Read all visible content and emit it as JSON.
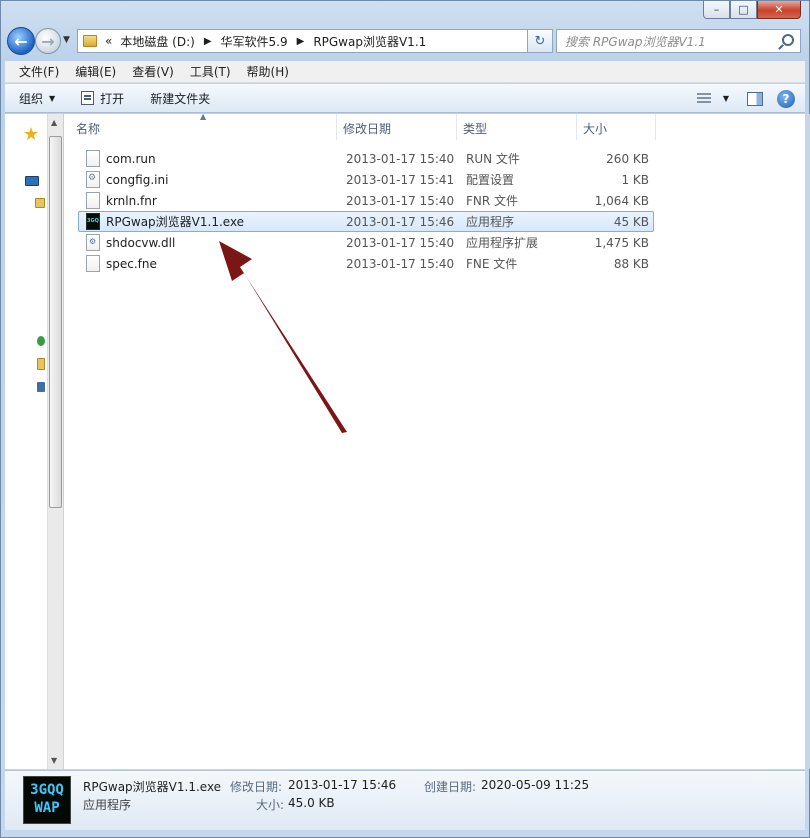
{
  "window": {
    "minimize": "–",
    "maximize": "□",
    "close": "✕"
  },
  "address": {
    "overflow": "«",
    "crumbs": [
      "本地磁盘 (D:)",
      "华军软件5.9",
      "RPGwap浏览器V1.1"
    ],
    "sep": "▶",
    "dropdown": "▼",
    "refresh": "↻"
  },
  "search": {
    "placeholder": "搜索 RPGwap浏览器V1.1"
  },
  "menu": [
    "文件(F)",
    "编辑(E)",
    "查看(V)",
    "工具(T)",
    "帮助(H)"
  ],
  "toolbar": {
    "organize": "组织",
    "open": "打开",
    "new_folder": "新建文件夹",
    "help": "?"
  },
  "columns": {
    "name": "名称",
    "date": "修改日期",
    "type": "类型",
    "size": "大小"
  },
  "files": [
    {
      "name": "com.run",
      "date": "2013-01-17 15:40",
      "type": "RUN 文件",
      "size": "260 KB",
      "icon": "file-icon"
    },
    {
      "name": "congfig.ini",
      "date": "2013-01-17 15:41",
      "type": "配置设置",
      "size": "1 KB",
      "icon": "config-file-icon"
    },
    {
      "name": "krnln.fnr",
      "date": "2013-01-17 15:40",
      "type": "FNR 文件",
      "size": "1,064 KB",
      "icon": "file-icon"
    },
    {
      "name": "RPGwap浏览器V1.1.exe",
      "date": "2013-01-17 15:46",
      "type": "应用程序",
      "size": "45 KB",
      "icon": "app-icon",
      "selected": true
    },
    {
      "name": "shdocvw.dll",
      "date": "2013-01-17 15:40",
      "type": "应用程序扩展",
      "size": "1,475 KB",
      "icon": "dll-icon"
    },
    {
      "name": "spec.fne",
      "date": "2013-01-17 15:40",
      "type": "FNE 文件",
      "size": "88 KB",
      "icon": "file-icon"
    }
  ],
  "details": {
    "name": "RPGwap浏览器V1.1.exe",
    "type": "应用程序",
    "modified_label": "修改日期:",
    "modified": "2013-01-17 15:46",
    "created_label": "创建日期:",
    "created": "2020-05-09 11:25",
    "size_label": "大小:",
    "size": "45.0 KB",
    "thumb_line1": "3GQQ",
    "thumb_line2": "WAP"
  },
  "colors": {
    "arrow": "#7a1616",
    "selection_border": "#84acdd"
  }
}
